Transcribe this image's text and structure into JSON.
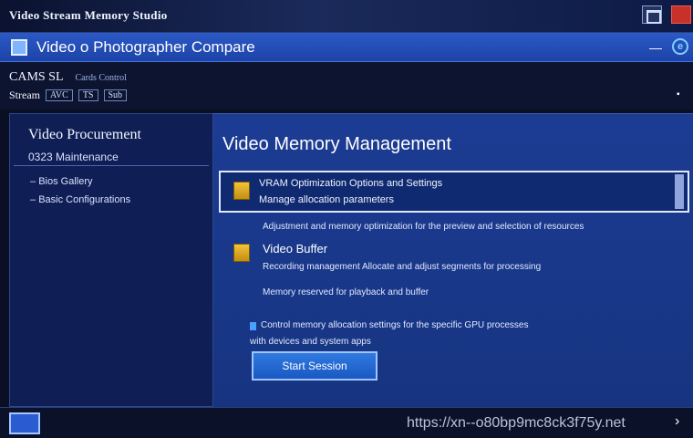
{
  "outer_window": {
    "title": "Video Stream Memory Studio"
  },
  "app_window": {
    "title": "Video o Photographer Compare"
  },
  "toolbar": {
    "row1_main": "CAMS SL",
    "row1_small": "Cards Control",
    "row2_label": "Stream",
    "row2_chips": [
      "AVC",
      "TS",
      "Sub"
    ]
  },
  "sidebar": {
    "heading": "Video Procurement",
    "subheading": "0323 Maintenance",
    "items": [
      "Bios Gallery",
      "Basic Configurations"
    ]
  },
  "main": {
    "title": "Video Memory Management",
    "card": {
      "line1": "VRAM Optimization Options and Settings",
      "line2": "Manage allocation parameters"
    },
    "card_desc": "Adjustment and memory optimization for the preview and selection of resources",
    "section_title": "Video Buffer",
    "section_desc1": "Recording management      Allocate and adjust segments for processing",
    "section_desc2": "Memory reserved for playback and buffer",
    "note_line1": "Control memory allocation settings for the specific GPU processes",
    "note_line2": "with devices and system apps",
    "action_button": "Start Session"
  },
  "status_bar": {
    "url": "https://xn--o80bp9mc8ck3f75y.net"
  }
}
